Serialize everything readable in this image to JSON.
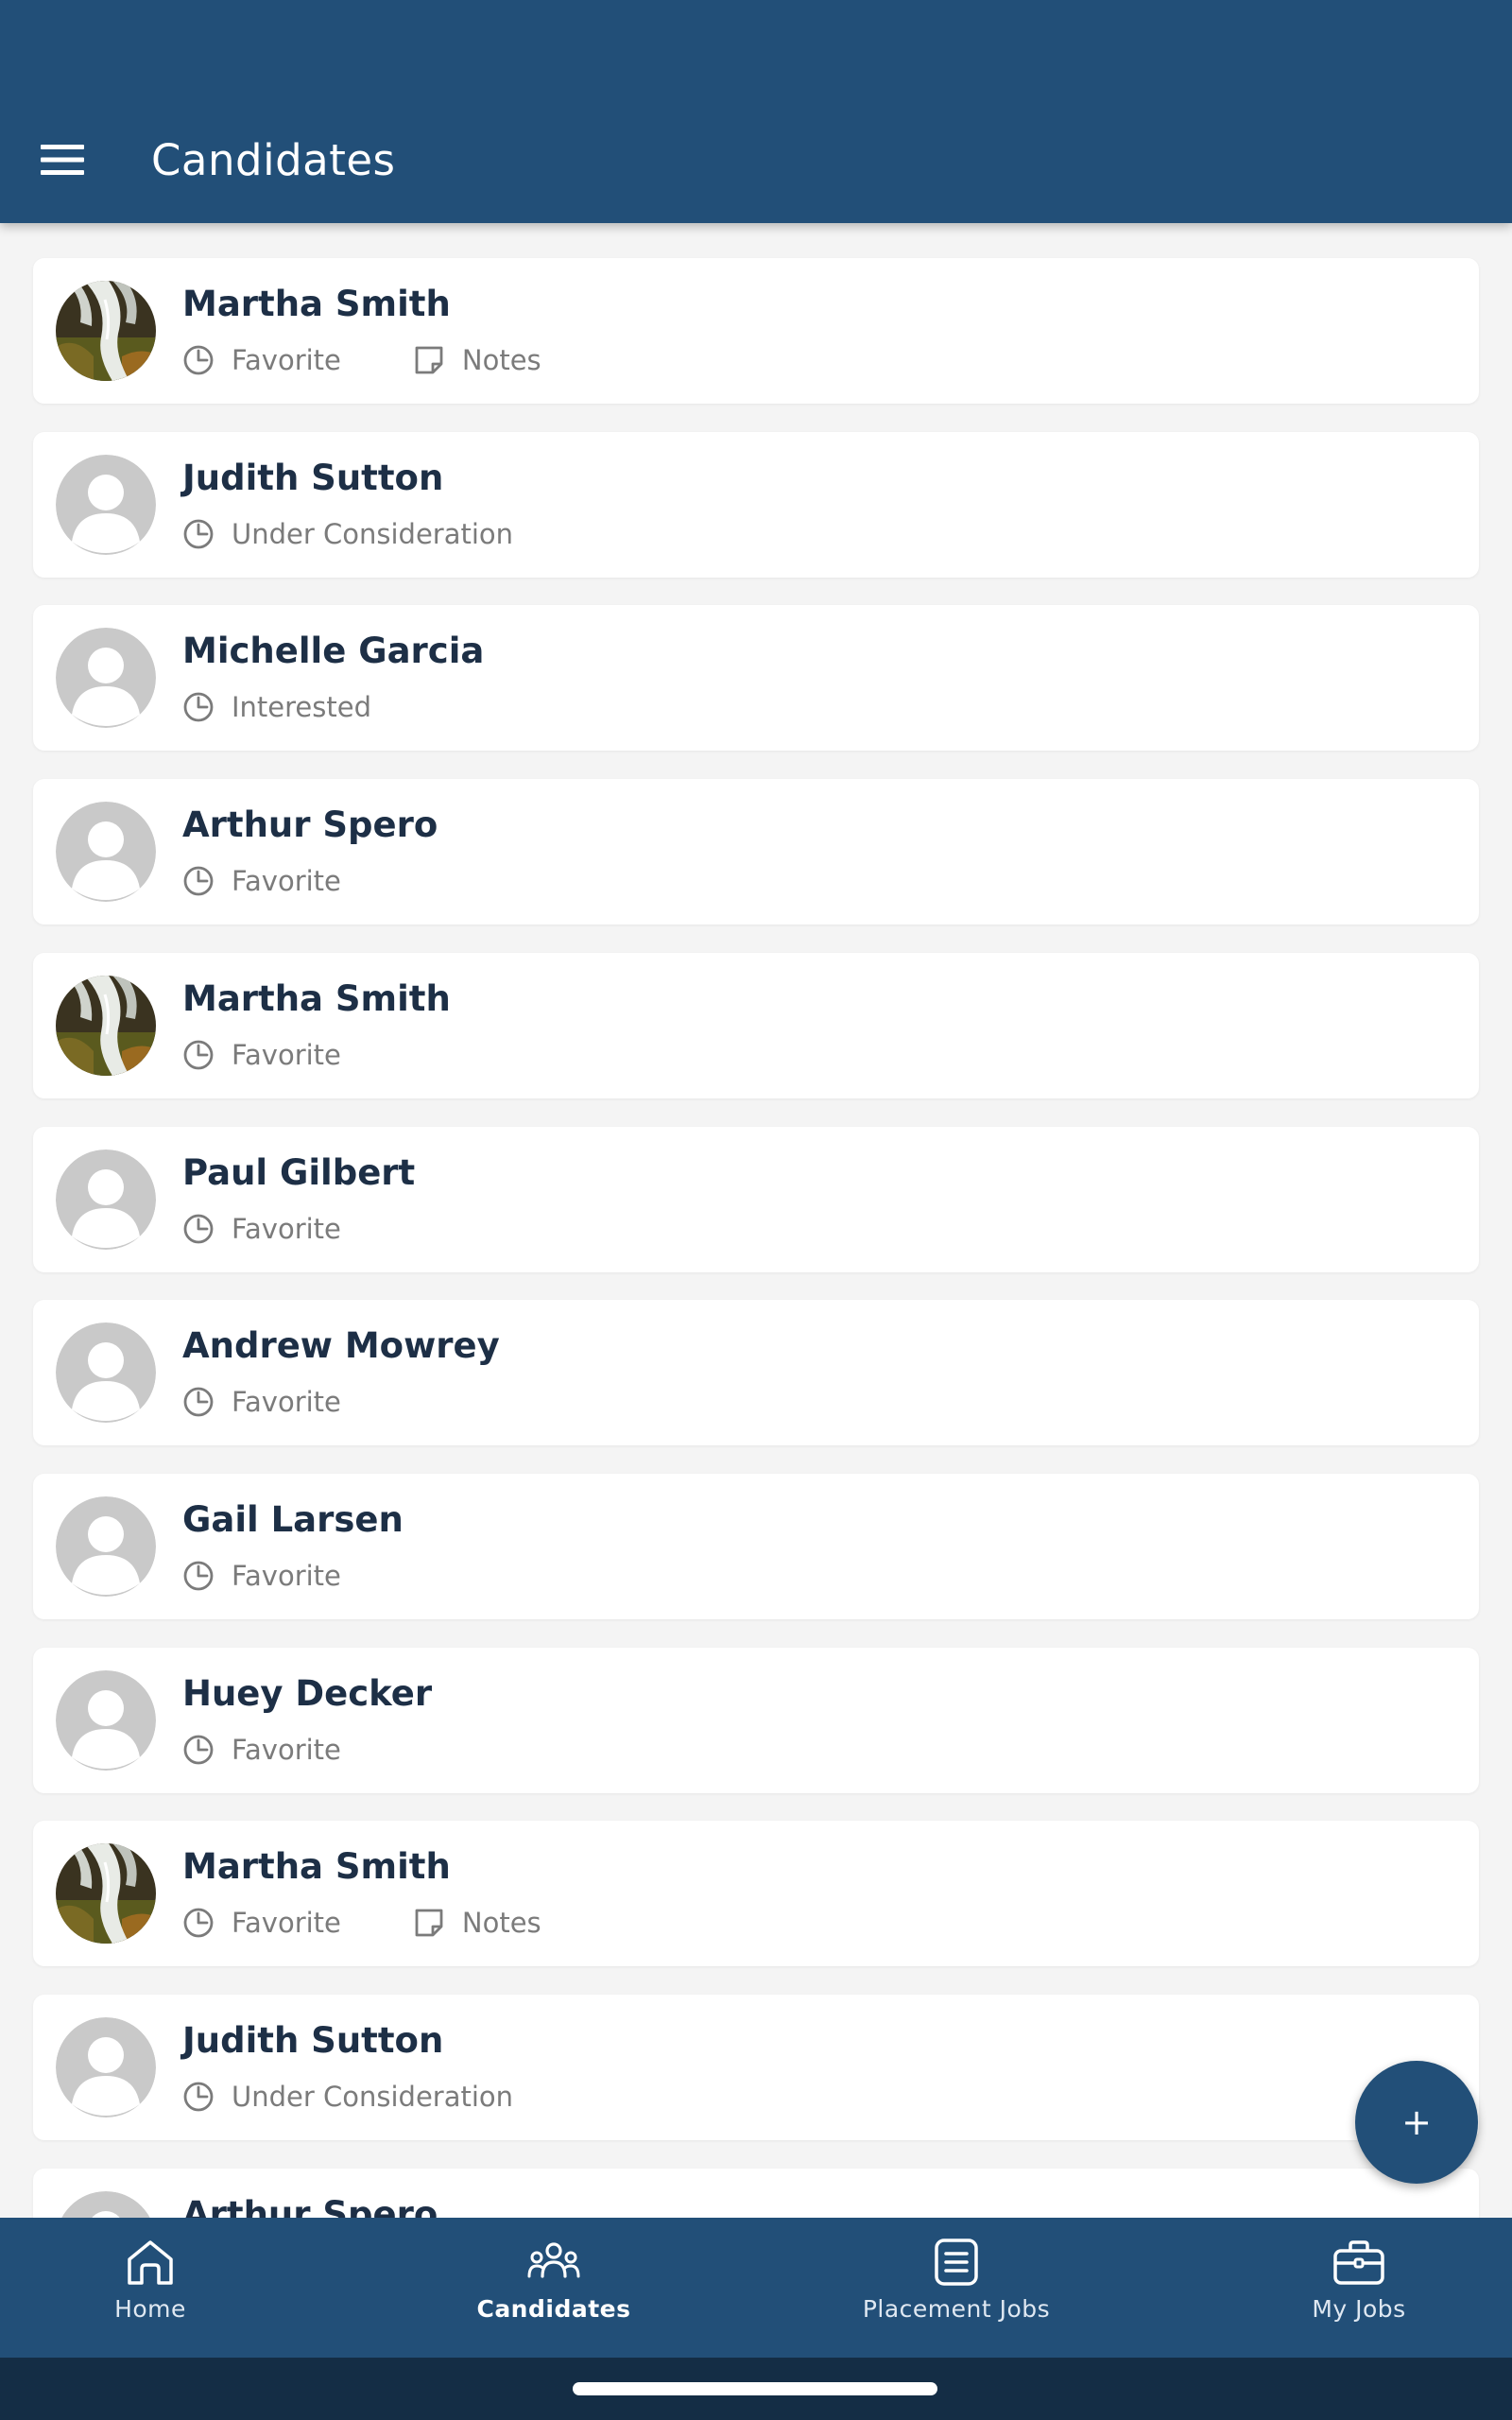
{
  "header": {
    "title": "Candidates",
    "menu_icon": "hamburger-menu-icon",
    "background": "#224f78"
  },
  "candidates": [
    {
      "name": "Martha Smith",
      "status": "Favorite",
      "notes": "Notes",
      "avatar": "photo"
    },
    {
      "name": "Judith Sutton",
      "status": "Under Consideration",
      "notes": "",
      "avatar": "placeholder"
    },
    {
      "name": "Michelle Garcia",
      "status": "Interested",
      "notes": "",
      "avatar": "placeholder"
    },
    {
      "name": "Arthur Spero",
      "status": "Favorite",
      "notes": "",
      "avatar": "placeholder"
    },
    {
      "name": "Martha Smith",
      "status": "Favorite",
      "notes": "",
      "avatar": "photo"
    },
    {
      "name": "Paul Gilbert",
      "status": "Favorite",
      "notes": "",
      "avatar": "placeholder"
    },
    {
      "name": "Andrew Mowrey",
      "status": "Favorite",
      "notes": "",
      "avatar": "placeholder"
    },
    {
      "name": "Gail Larsen",
      "status": "Favorite",
      "notes": "",
      "avatar": "placeholder"
    },
    {
      "name": "Huey Decker",
      "status": "Favorite",
      "notes": "",
      "avatar": "placeholder"
    },
    {
      "name": "Martha Smith",
      "status": "Favorite",
      "notes": "Notes",
      "avatar": "photo"
    },
    {
      "name": "Judith Sutton",
      "status": "Under Consideration",
      "notes": "",
      "avatar": "placeholder"
    },
    {
      "name": "Arthur Spero",
      "status": "",
      "notes": "",
      "avatar": "placeholder"
    }
  ],
  "fab": {
    "label": "+",
    "icon": "plus-icon"
  },
  "bottom_nav": {
    "items": [
      {
        "label": "Home",
        "icon": "home-icon"
      },
      {
        "label": "Candidates",
        "icon": "people-icon",
        "active": true
      },
      {
        "label": "Placement Jobs",
        "icon": "document-list-icon"
      },
      {
        "label": "My Jobs",
        "icon": "briefcase-icon"
      }
    ]
  },
  "colors": {
    "primary": "#224f78",
    "name_text": "#1d2f46",
    "meta_text": "#7b7b7b",
    "list_background": "#f4f4f4",
    "system_bar": "#142d45"
  }
}
